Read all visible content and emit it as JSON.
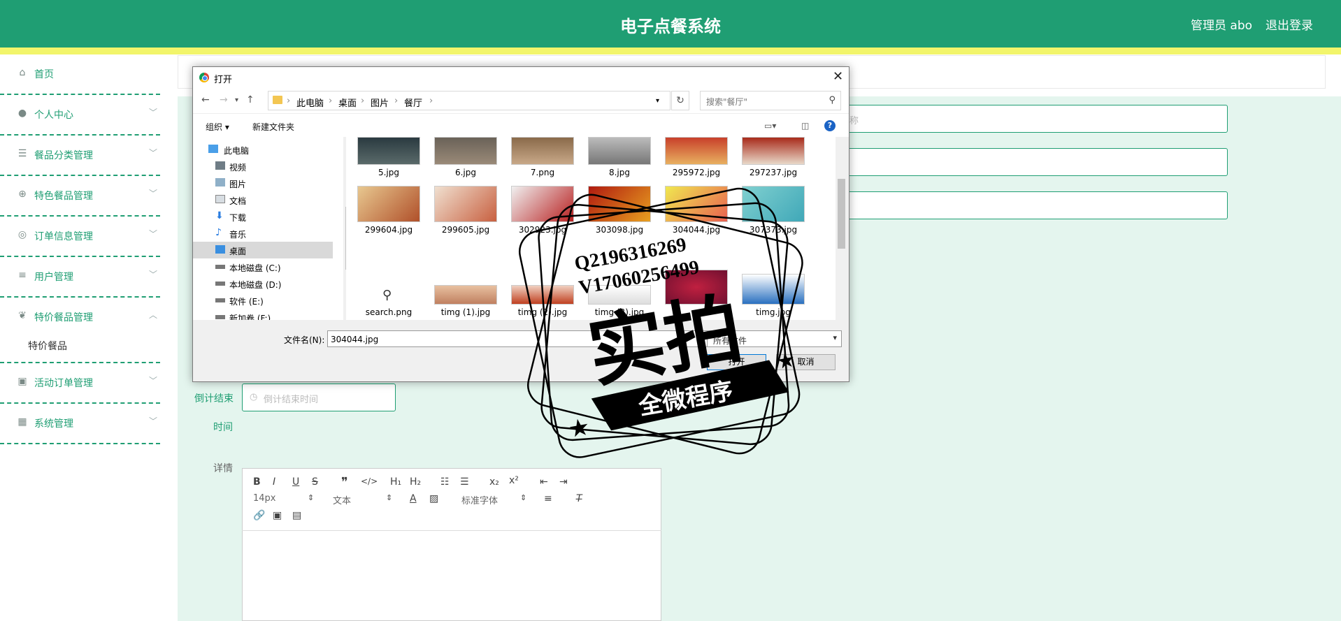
{
  "header": {
    "title": "电子点餐系统",
    "user": "管理员 abo",
    "logout": "退出登录"
  },
  "colors": {
    "accent": "#1f9e73",
    "strip": "#f2f56b",
    "main_bg": "#e4f5ee"
  },
  "sidebar": {
    "items": [
      {
        "label": "首页",
        "icon": "home-icon"
      },
      {
        "label": "个人中心",
        "icon": "user-icon"
      },
      {
        "label": "餐品分类管理",
        "icon": "sliders-icon"
      },
      {
        "label": "特色餐品管理",
        "icon": "compass-icon"
      },
      {
        "label": "订单信息管理",
        "icon": "target-icon"
      },
      {
        "label": "用户管理",
        "icon": "list-icon"
      },
      {
        "label": "特价餐品管理",
        "icon": "leaf-icon"
      },
      {
        "label": "活动订单管理",
        "icon": "clipboard-icon"
      },
      {
        "label": "系统管理",
        "icon": "grid-icon"
      }
    ],
    "sub_item": "特价餐品"
  },
  "form": {
    "field1_placeholder": "称",
    "countdown_label": "倒计结束",
    "countdown_label2": "时间",
    "countdown_placeholder": "倒计结束时间",
    "detail_label": "详情"
  },
  "editor": {
    "font_size": "14px",
    "text_type": "文本",
    "font_family": "标准字体"
  },
  "dialog": {
    "title": "打开",
    "breadcrumb": [
      "此电脑",
      "桌面",
      "图片",
      "餐厅"
    ],
    "search_placeholder": "搜索\"餐厅\"",
    "organize": "组织 ▾",
    "new_folder": "新建文件夹",
    "tree": [
      "此电脑",
      "视频",
      "图片",
      "文档",
      "下载",
      "音乐",
      "桌面",
      "本地磁盘 (C:)",
      "本地磁盘 (D:)",
      "软件 (E:)",
      "新加卷 (F:)"
    ],
    "files_row1": [
      "5.jpg",
      "6.jpg",
      "7.png",
      "8.jpg",
      "295972.jpg",
      "297237.jpg"
    ],
    "files_row2": [
      "299604.jpg",
      "299605.jpg",
      "302923.jpg",
      "303098.jpg",
      "304044.jpg",
      "307373.jpg"
    ],
    "files_row3": [
      "search.png",
      "timg (1).jpg",
      "timg (2).jpg",
      "timg (3).jpg",
      "timg.jpg"
    ],
    "filename_label": "文件名(N):",
    "filename_value": "304044.jpg",
    "filter": "所有文件",
    "open_btn": "打开",
    "cancel_btn": "取消"
  },
  "watermark": {
    "line1": "Q2196316269",
    "line2": "V17060256499",
    "big": "实拍",
    "ribbon": "全微程序"
  }
}
